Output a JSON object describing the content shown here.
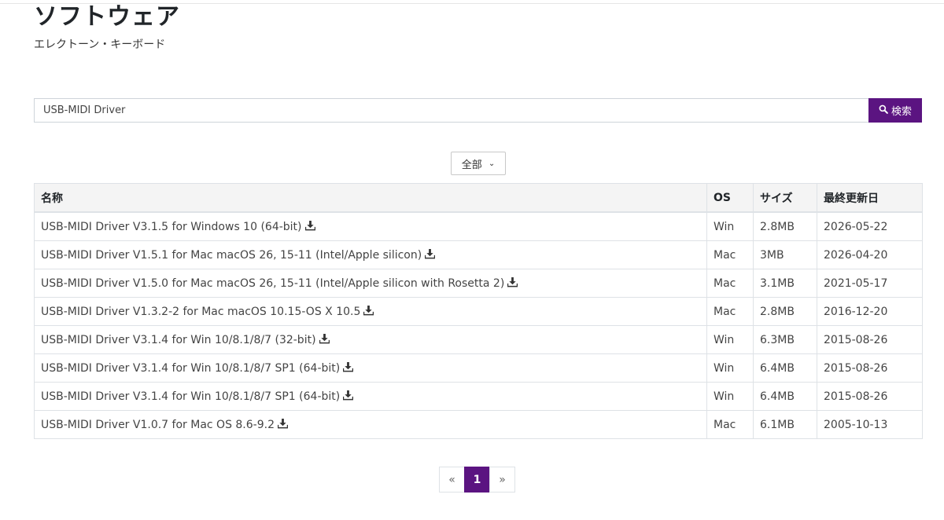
{
  "header": {
    "title": "ソフトウェア",
    "subtitle": "エレクトーン・キーボード"
  },
  "search": {
    "value": "USB-MIDI Driver",
    "button_label": "検索",
    "button_icon": "search-icon"
  },
  "filter": {
    "selected": "全部"
  },
  "table": {
    "headers": [
      "名称",
      "OS",
      "サイズ",
      "最終更新日"
    ],
    "rows": [
      {
        "name": "USB-MIDI Driver V3.1.5 for Windows 10 (64-bit)",
        "os": "Win",
        "size": "2.8MB",
        "date": "2026-05-22"
      },
      {
        "name": "USB-MIDI Driver V1.5.1 for Mac macOS 26, 15-11 (Intel/Apple silicon)",
        "os": "Mac",
        "size": "3MB",
        "date": "2026-04-20"
      },
      {
        "name": "USB-MIDI Driver V1.5.0 for Mac macOS 26, 15-11 (Intel/Apple silicon with Rosetta 2)",
        "os": "Mac",
        "size": "3.1MB",
        "date": "2021-05-17"
      },
      {
        "name": "USB-MIDI Driver V1.3.2-2 for Mac macOS 10.15-OS X 10.5",
        "os": "Mac",
        "size": "2.8MB",
        "date": "2016-12-20"
      },
      {
        "name": "USB-MIDI Driver V3.1.4 for Win 10/8.1/8/7 (32-bit)",
        "os": "Win",
        "size": "6.3MB",
        "date": "2015-08-26"
      },
      {
        "name": "USB-MIDI Driver V3.1.4 for Win 10/8.1/8/7 SP1 (64-bit)",
        "os": "Win",
        "size": "6.4MB",
        "date": "2015-08-26"
      },
      {
        "name": "USB-MIDI Driver V3.1.4 for Win 10/8.1/8/7 SP1 (64-bit)",
        "os": "Win",
        "size": "6.4MB",
        "date": "2015-08-26"
      },
      {
        "name": "USB-MIDI Driver V1.0.7 for Mac OS 8.6-9.2",
        "os": "Mac",
        "size": "6.1MB",
        "date": "2005-10-13"
      }
    ]
  },
  "pagination": {
    "prev": "«",
    "current": "1",
    "next": "»"
  },
  "colors": {
    "accent": "#5b1481",
    "header_bg": "#f4f4f4",
    "border": "#dee2e6"
  }
}
